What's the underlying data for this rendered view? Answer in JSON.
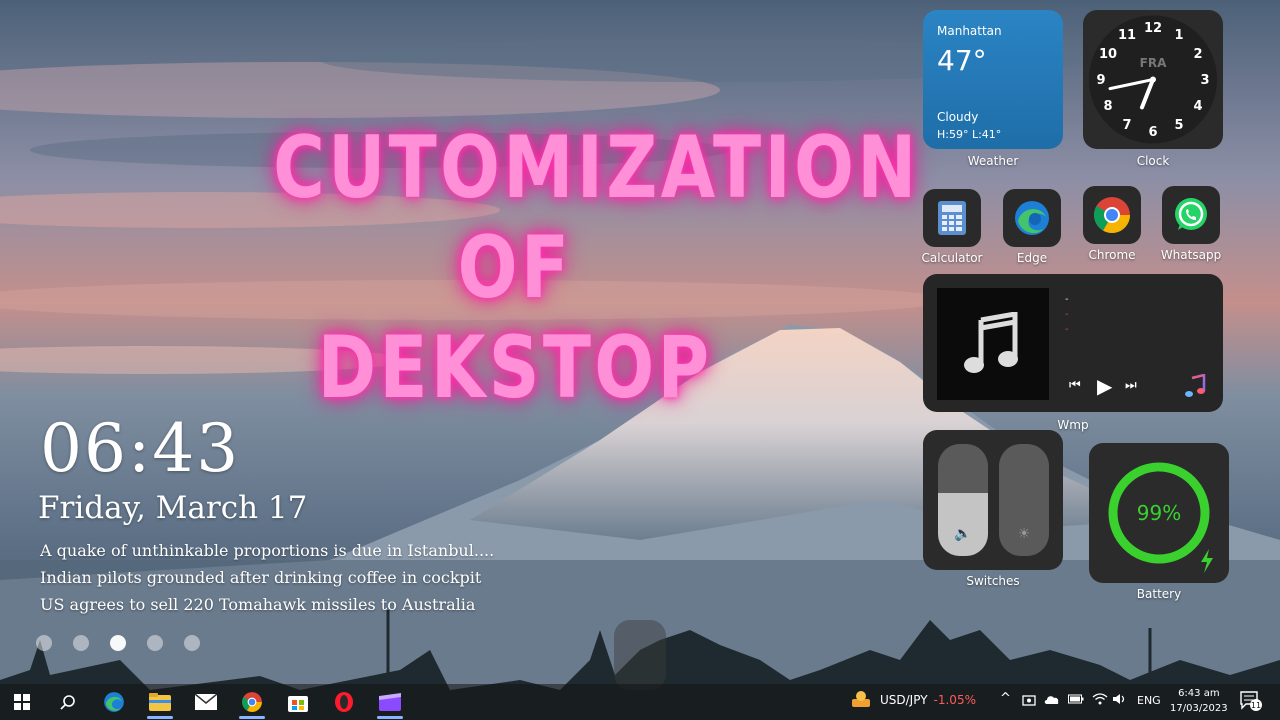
{
  "headline": {
    "line1": "CUTOMIZATION",
    "line2": "OF DEKSTOP"
  },
  "lockscreen": {
    "time": "06:43",
    "date": "Friday, March 17",
    "news": [
      "A quake of unthinkable proportions is due in Istanbul....",
      "Indian pilots grounded after drinking coffee in cockpit",
      "US agrees to sell 220 Tomahawk missiles to Australia"
    ],
    "page_dots": 5,
    "active_dot": 3
  },
  "weather": {
    "city": "Manhattan",
    "temperature": "47°",
    "condition": "Cloudy",
    "high_low": "H:59° L:41°",
    "label": "Weather"
  },
  "clock": {
    "label": "Clock",
    "day_abbr": "FRA",
    "numerals": [
      "12",
      "1",
      "2",
      "3",
      "4",
      "5",
      "6",
      "7",
      "8",
      "9",
      "10",
      "11"
    ],
    "hour": 6,
    "minute": 43
  },
  "apps": [
    {
      "label": "Calculator",
      "icon": "calculator-icon"
    },
    {
      "label": "Edge",
      "icon": "edge-icon"
    },
    {
      "label": "Chrome",
      "icon": "chrome-icon"
    },
    {
      "label": "Whatsapp",
      "icon": "whatsapp-icon"
    }
  ],
  "media": {
    "label": "Wmp",
    "title": "-",
    "artist": "-",
    "album": "-",
    "prev": "⏮",
    "play": "▶",
    "next": "⏭"
  },
  "switches": {
    "label": "Switches",
    "volume_level": 0.56,
    "brightness_level": 0.0
  },
  "battery": {
    "label": "Battery",
    "percent_text": "99%",
    "percent": 99,
    "color": "#3ad12f"
  },
  "taskbar": {
    "ticker_symbol": "USD/JPY",
    "ticker_change": "-1.05%",
    "language": "ENG",
    "time": "6:43 am",
    "date": "17/03/2023",
    "notification_count": "11",
    "pinned": [
      "start-icon",
      "search-icon",
      "edge-icon",
      "file-explorer-icon",
      "mail-icon",
      "chrome-icon",
      "store-icon",
      "opera-icon",
      "clipchamp-icon"
    ]
  },
  "colors": {
    "neon_pink": "#ff8fd6",
    "weather_blue": "#2b84c4",
    "widget_dark": "#2b2b2b",
    "battery_green": "#3ad12f",
    "down_red": "#ff5a5a"
  }
}
